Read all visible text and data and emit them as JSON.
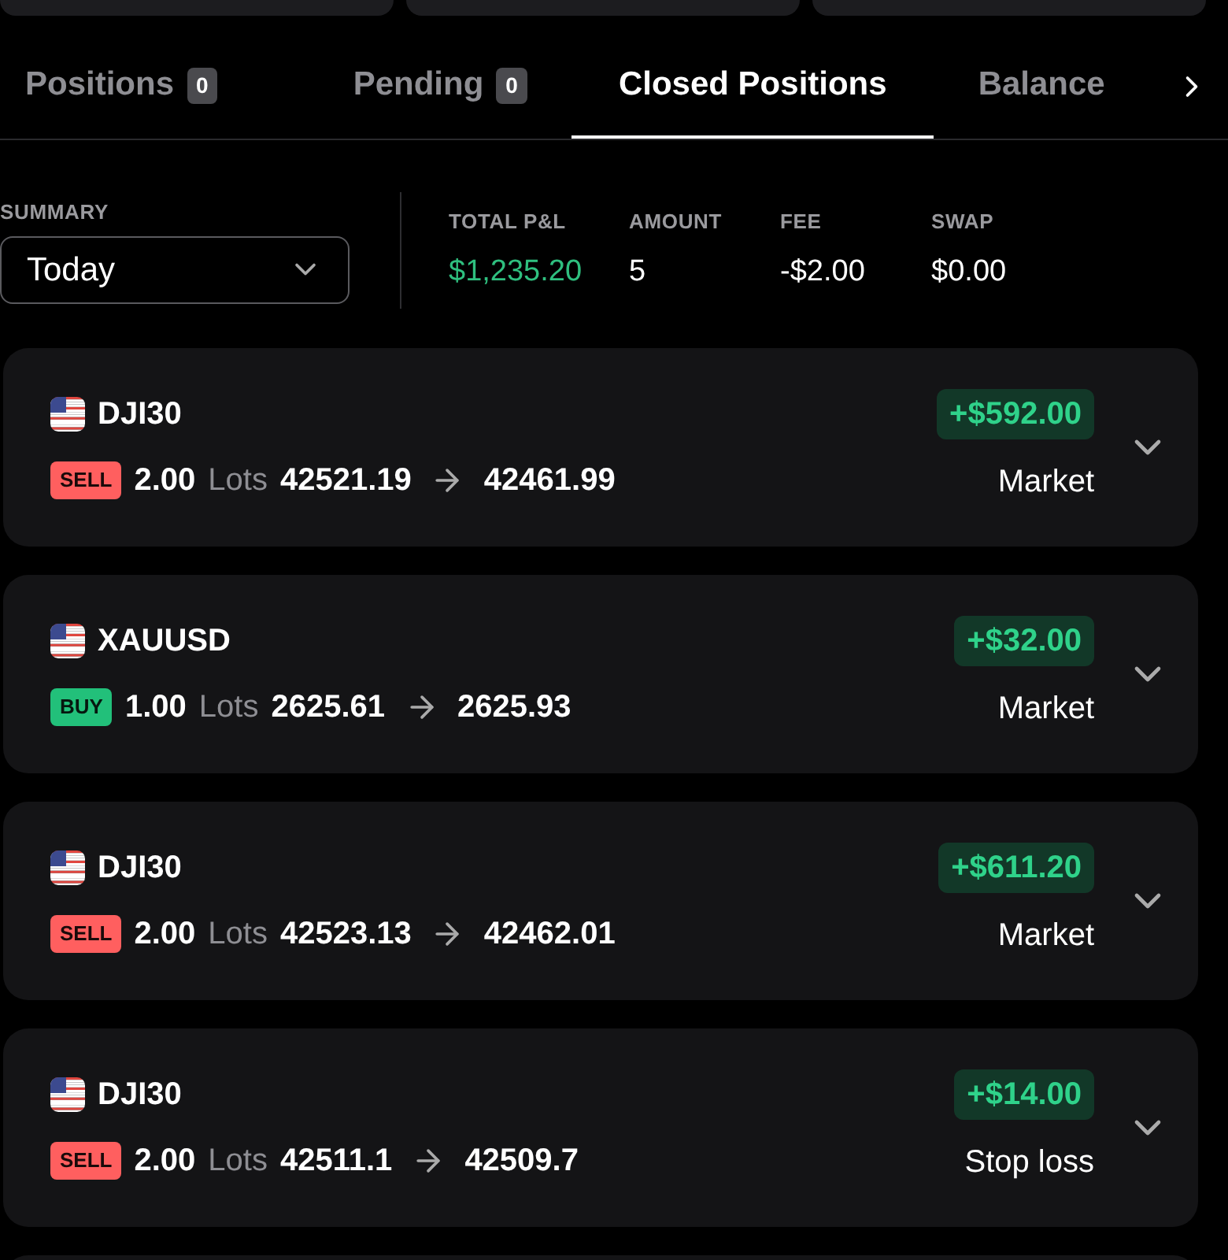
{
  "tabs": [
    {
      "label": "Positions",
      "count": "0",
      "selected": false
    },
    {
      "label": "Pending",
      "count": "0",
      "selected": false
    },
    {
      "label": "Closed Positions",
      "selected": true
    },
    {
      "label": "Balance",
      "selected": false
    }
  ],
  "summary": {
    "label": "SUMMARY",
    "period": "Today",
    "stats": [
      {
        "label": "TOTAL P&L",
        "value": "$1,235.20",
        "kind": "profit"
      },
      {
        "label": "AMOUNT",
        "value": "5",
        "kind": "plain"
      },
      {
        "label": "FEE",
        "value": "-$2.00",
        "kind": "plain"
      },
      {
        "label": "SWAP",
        "value": "$0.00",
        "kind": "plain"
      }
    ]
  },
  "positions": [
    {
      "symbol": "DJI30",
      "side": "SELL",
      "kind": "sell",
      "lots": "2.00",
      "lots_label": "Lots",
      "open": "42521.19",
      "close": "42461.99",
      "pnl": "+$592.00",
      "close_type": "Market"
    },
    {
      "symbol": "XAUUSD",
      "side": "BUY",
      "kind": "buy",
      "lots": "1.00",
      "lots_label": "Lots",
      "open": "2625.61",
      "close": "2625.93",
      "pnl": "+$32.00",
      "close_type": "Market"
    },
    {
      "symbol": "DJI30",
      "side": "SELL",
      "kind": "sell",
      "lots": "2.00",
      "lots_label": "Lots",
      "open": "42523.13",
      "close": "42462.01",
      "pnl": "+$611.20",
      "close_type": "Market"
    },
    {
      "symbol": "DJI30",
      "side": "SELL",
      "kind": "sell",
      "lots": "2.00",
      "lots_label": "Lots",
      "open": "42511.1",
      "close": "42509.7",
      "pnl": "+$14.00",
      "close_type": "Stop loss"
    }
  ]
}
